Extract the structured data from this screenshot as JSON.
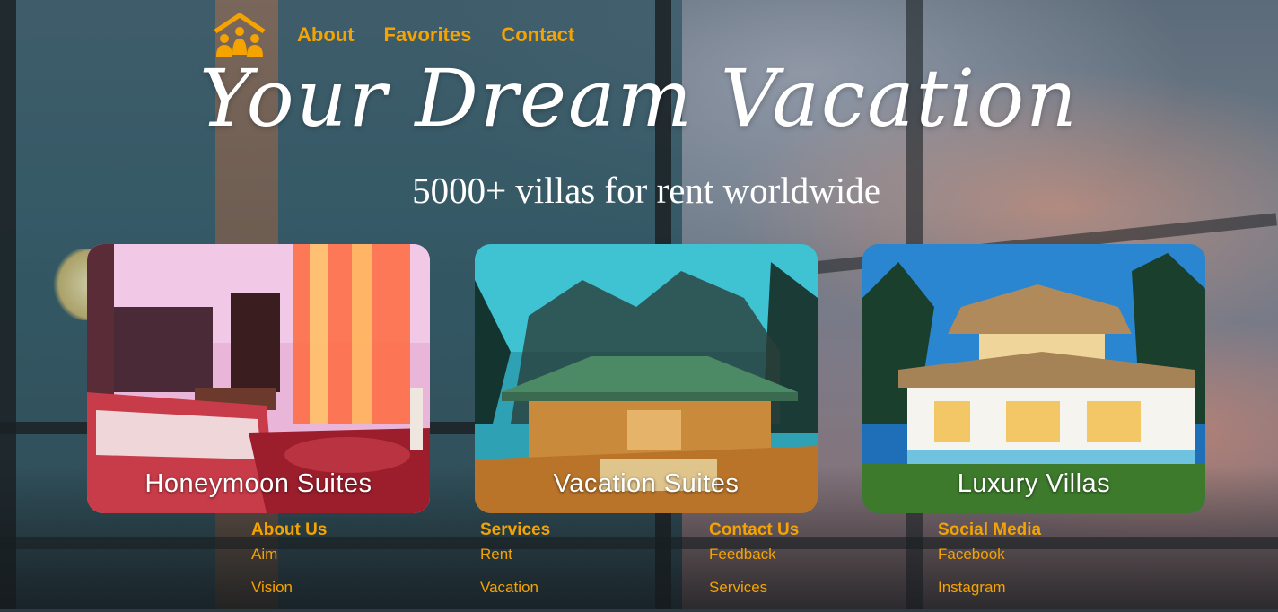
{
  "nav": {
    "logo_icon": "family-house-icon",
    "links": [
      "About",
      "Favorites",
      "Contact"
    ]
  },
  "hero": {
    "title": "Your Dream Vacation",
    "subtitle": "5000+ villas for rent worldwide"
  },
  "cards": [
    {
      "label": "Honeymoon Suites"
    },
    {
      "label": "Vacation Suites"
    },
    {
      "label": "Luxury Villas"
    }
  ],
  "footer": {
    "columns": [
      {
        "heading": "About Us",
        "links": [
          "Aim",
          "Vision"
        ]
      },
      {
        "heading": "Services",
        "links": [
          "Rent",
          "Vacation"
        ]
      },
      {
        "heading": "Contact Us",
        "links": [
          "Feedback",
          "Services"
        ]
      },
      {
        "heading": "Social Media",
        "links": [
          "Facebook",
          "Instagram"
        ]
      }
    ]
  },
  "colors": {
    "accent": "#f5a300",
    "text_light": "#ffffff"
  }
}
